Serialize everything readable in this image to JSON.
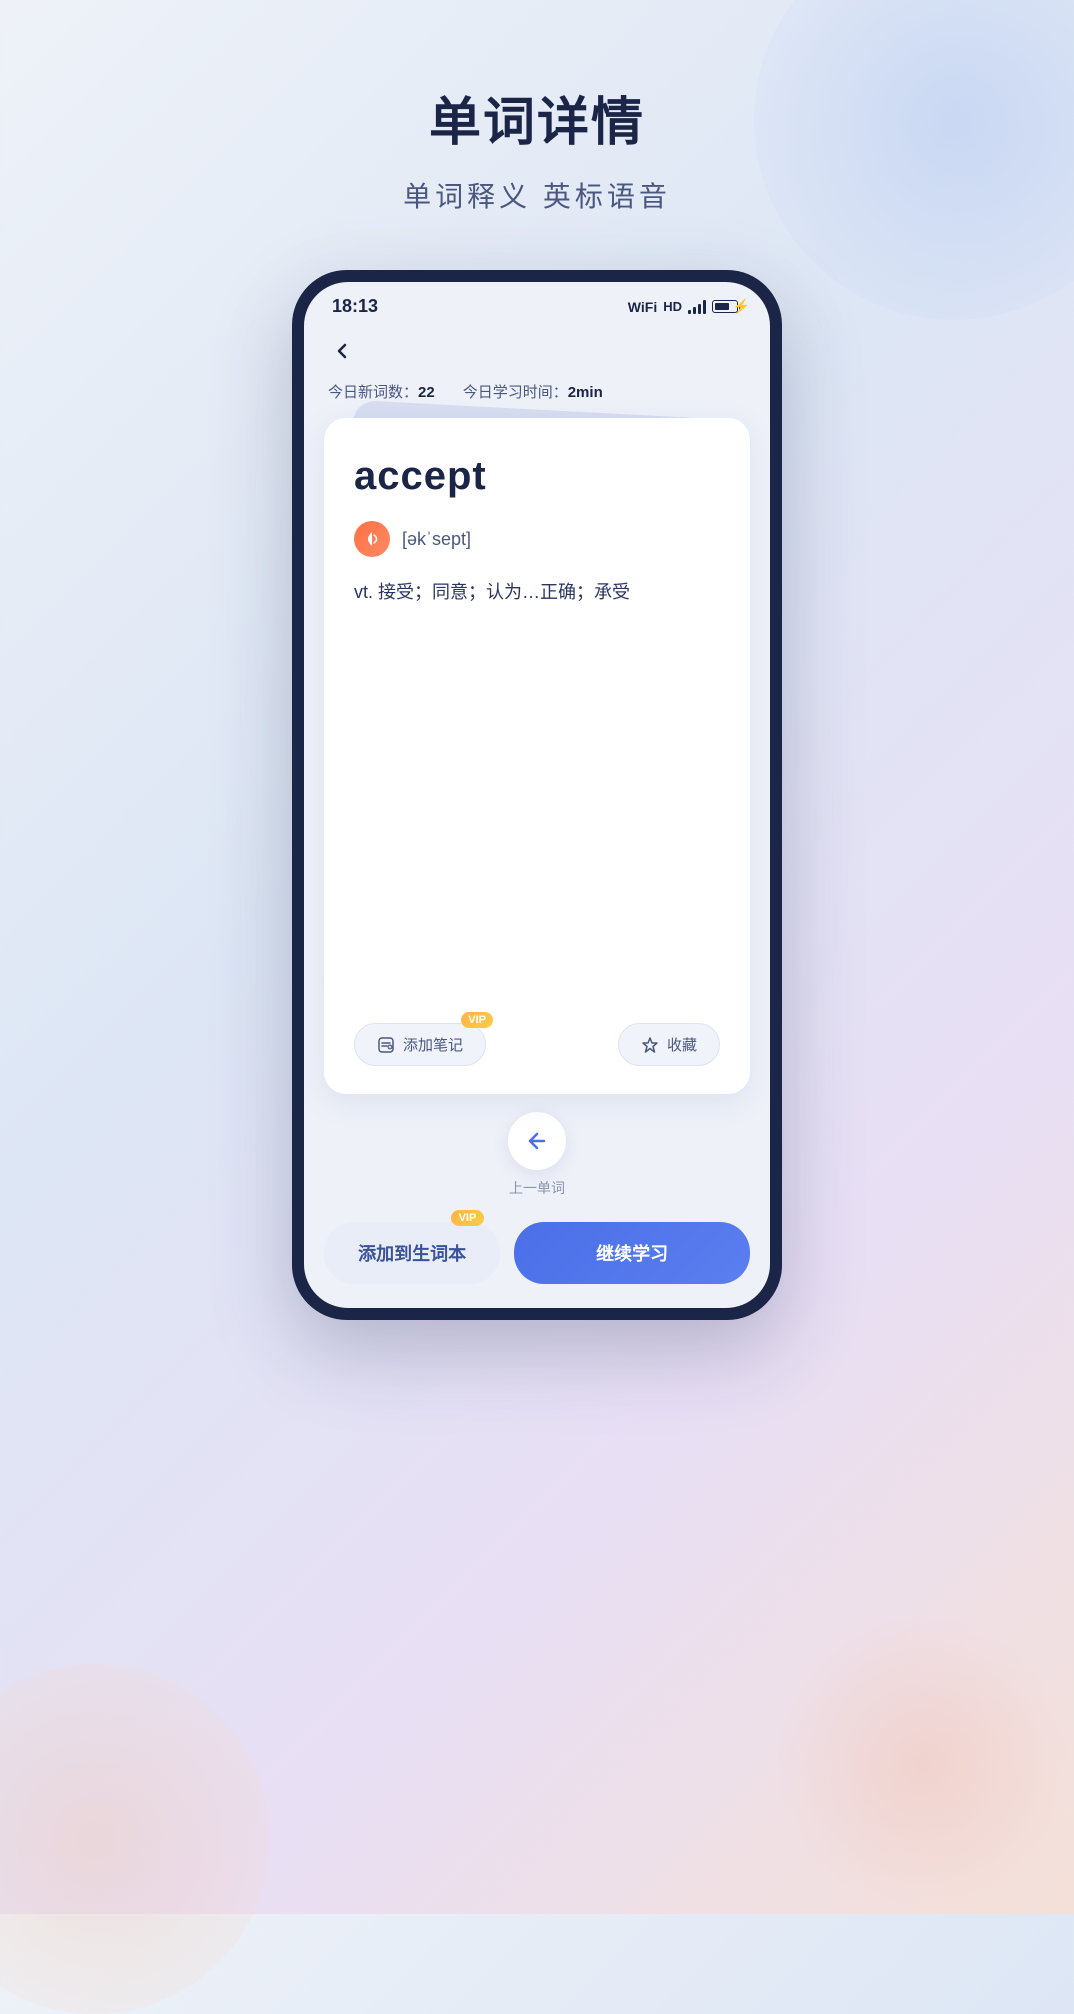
{
  "page": {
    "title": "单词详情",
    "subtitle": "单词释义 英标语音"
  },
  "status_bar": {
    "time": "18:13",
    "hd_label": "HD"
  },
  "header": {
    "back_label": "‹"
  },
  "stats": {
    "new_words_label": "今日新词数：",
    "new_words_value": "22",
    "study_time_label": "今日学习时间：",
    "study_time_value": "2min"
  },
  "word_card": {
    "word": "accept",
    "phonetic": "[əkˈsept]",
    "definition": "vt. 接受；同意；认为…正确；承受"
  },
  "card_buttons": {
    "note_label": "添加笔记",
    "note_vip": "VIP",
    "collect_label": "收藏"
  },
  "navigation": {
    "prev_label": "上一单词",
    "arrow": "←"
  },
  "bottom_buttons": {
    "vocabulary_label": "添加到生词本",
    "vocabulary_vip": "VIP",
    "continue_label": "继续学习"
  }
}
